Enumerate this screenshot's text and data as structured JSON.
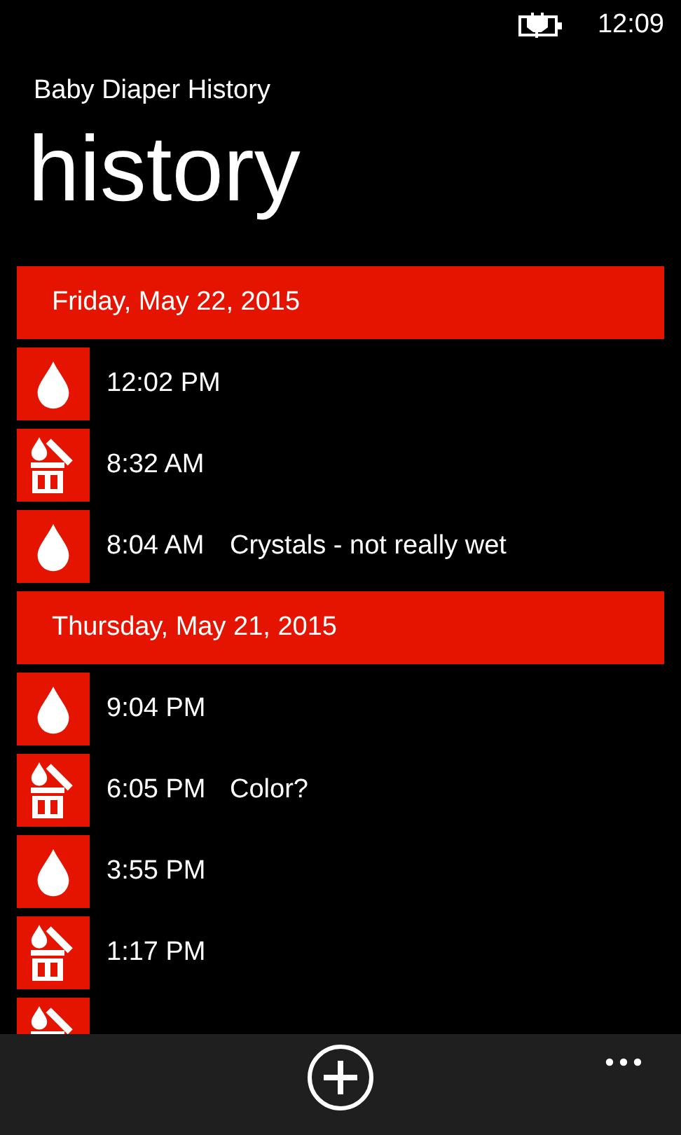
{
  "status_bar": {
    "time": "12:09"
  },
  "app_title": "Baby Diaper History",
  "page_title": "history",
  "groups": [
    {
      "date": "Friday, May 22, 2015",
      "entries": [
        {
          "kind": "wet",
          "time": "12:02 PM"
        },
        {
          "kind": "mixed",
          "time": "8:32 AM"
        },
        {
          "kind": "wet",
          "time": "8:04 AM",
          "note": "Crystals - not really wet"
        }
      ]
    },
    {
      "date": "Thursday, May 21, 2015",
      "entries": [
        {
          "kind": "wet",
          "time": "9:04 PM"
        },
        {
          "kind": "mixed",
          "time": "6:05 PM",
          "note": "Color?"
        },
        {
          "kind": "wet",
          "time": "3:55 PM"
        },
        {
          "kind": "mixed",
          "time": "1:17 PM"
        },
        {
          "kind": "mixed"
        }
      ]
    }
  ],
  "app_bar": {
    "buttons": [
      {
        "kind": "add"
      }
    ]
  }
}
